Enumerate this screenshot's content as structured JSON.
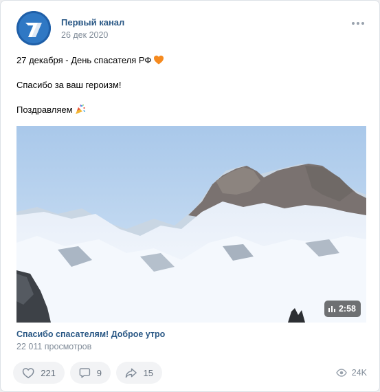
{
  "post": {
    "author": "Первый канал",
    "date": "26 дек 2020",
    "text_lines": [
      "27 декабря - День спасателя РФ",
      "Спасибо за ваш героизм!",
      "Поздравляем"
    ],
    "video": {
      "title": "Спасибо спасателям! Доброе утро",
      "views": "22 011 просмотров",
      "duration": "2:58"
    },
    "actions": {
      "likes": "221",
      "comments": "9",
      "shares": "15",
      "views": "24K"
    }
  },
  "colors": {
    "link": "#2a5885",
    "secondary": "#818c99",
    "action_bg": "#f2f3f5",
    "brand": "#2a6db5"
  },
  "icons": [
    "logo-icon",
    "more-icon",
    "heart-emoji-icon",
    "party-popper-emoji-icon",
    "play-stats-icon",
    "like-icon",
    "comment-icon",
    "share-icon",
    "views-icon"
  ]
}
